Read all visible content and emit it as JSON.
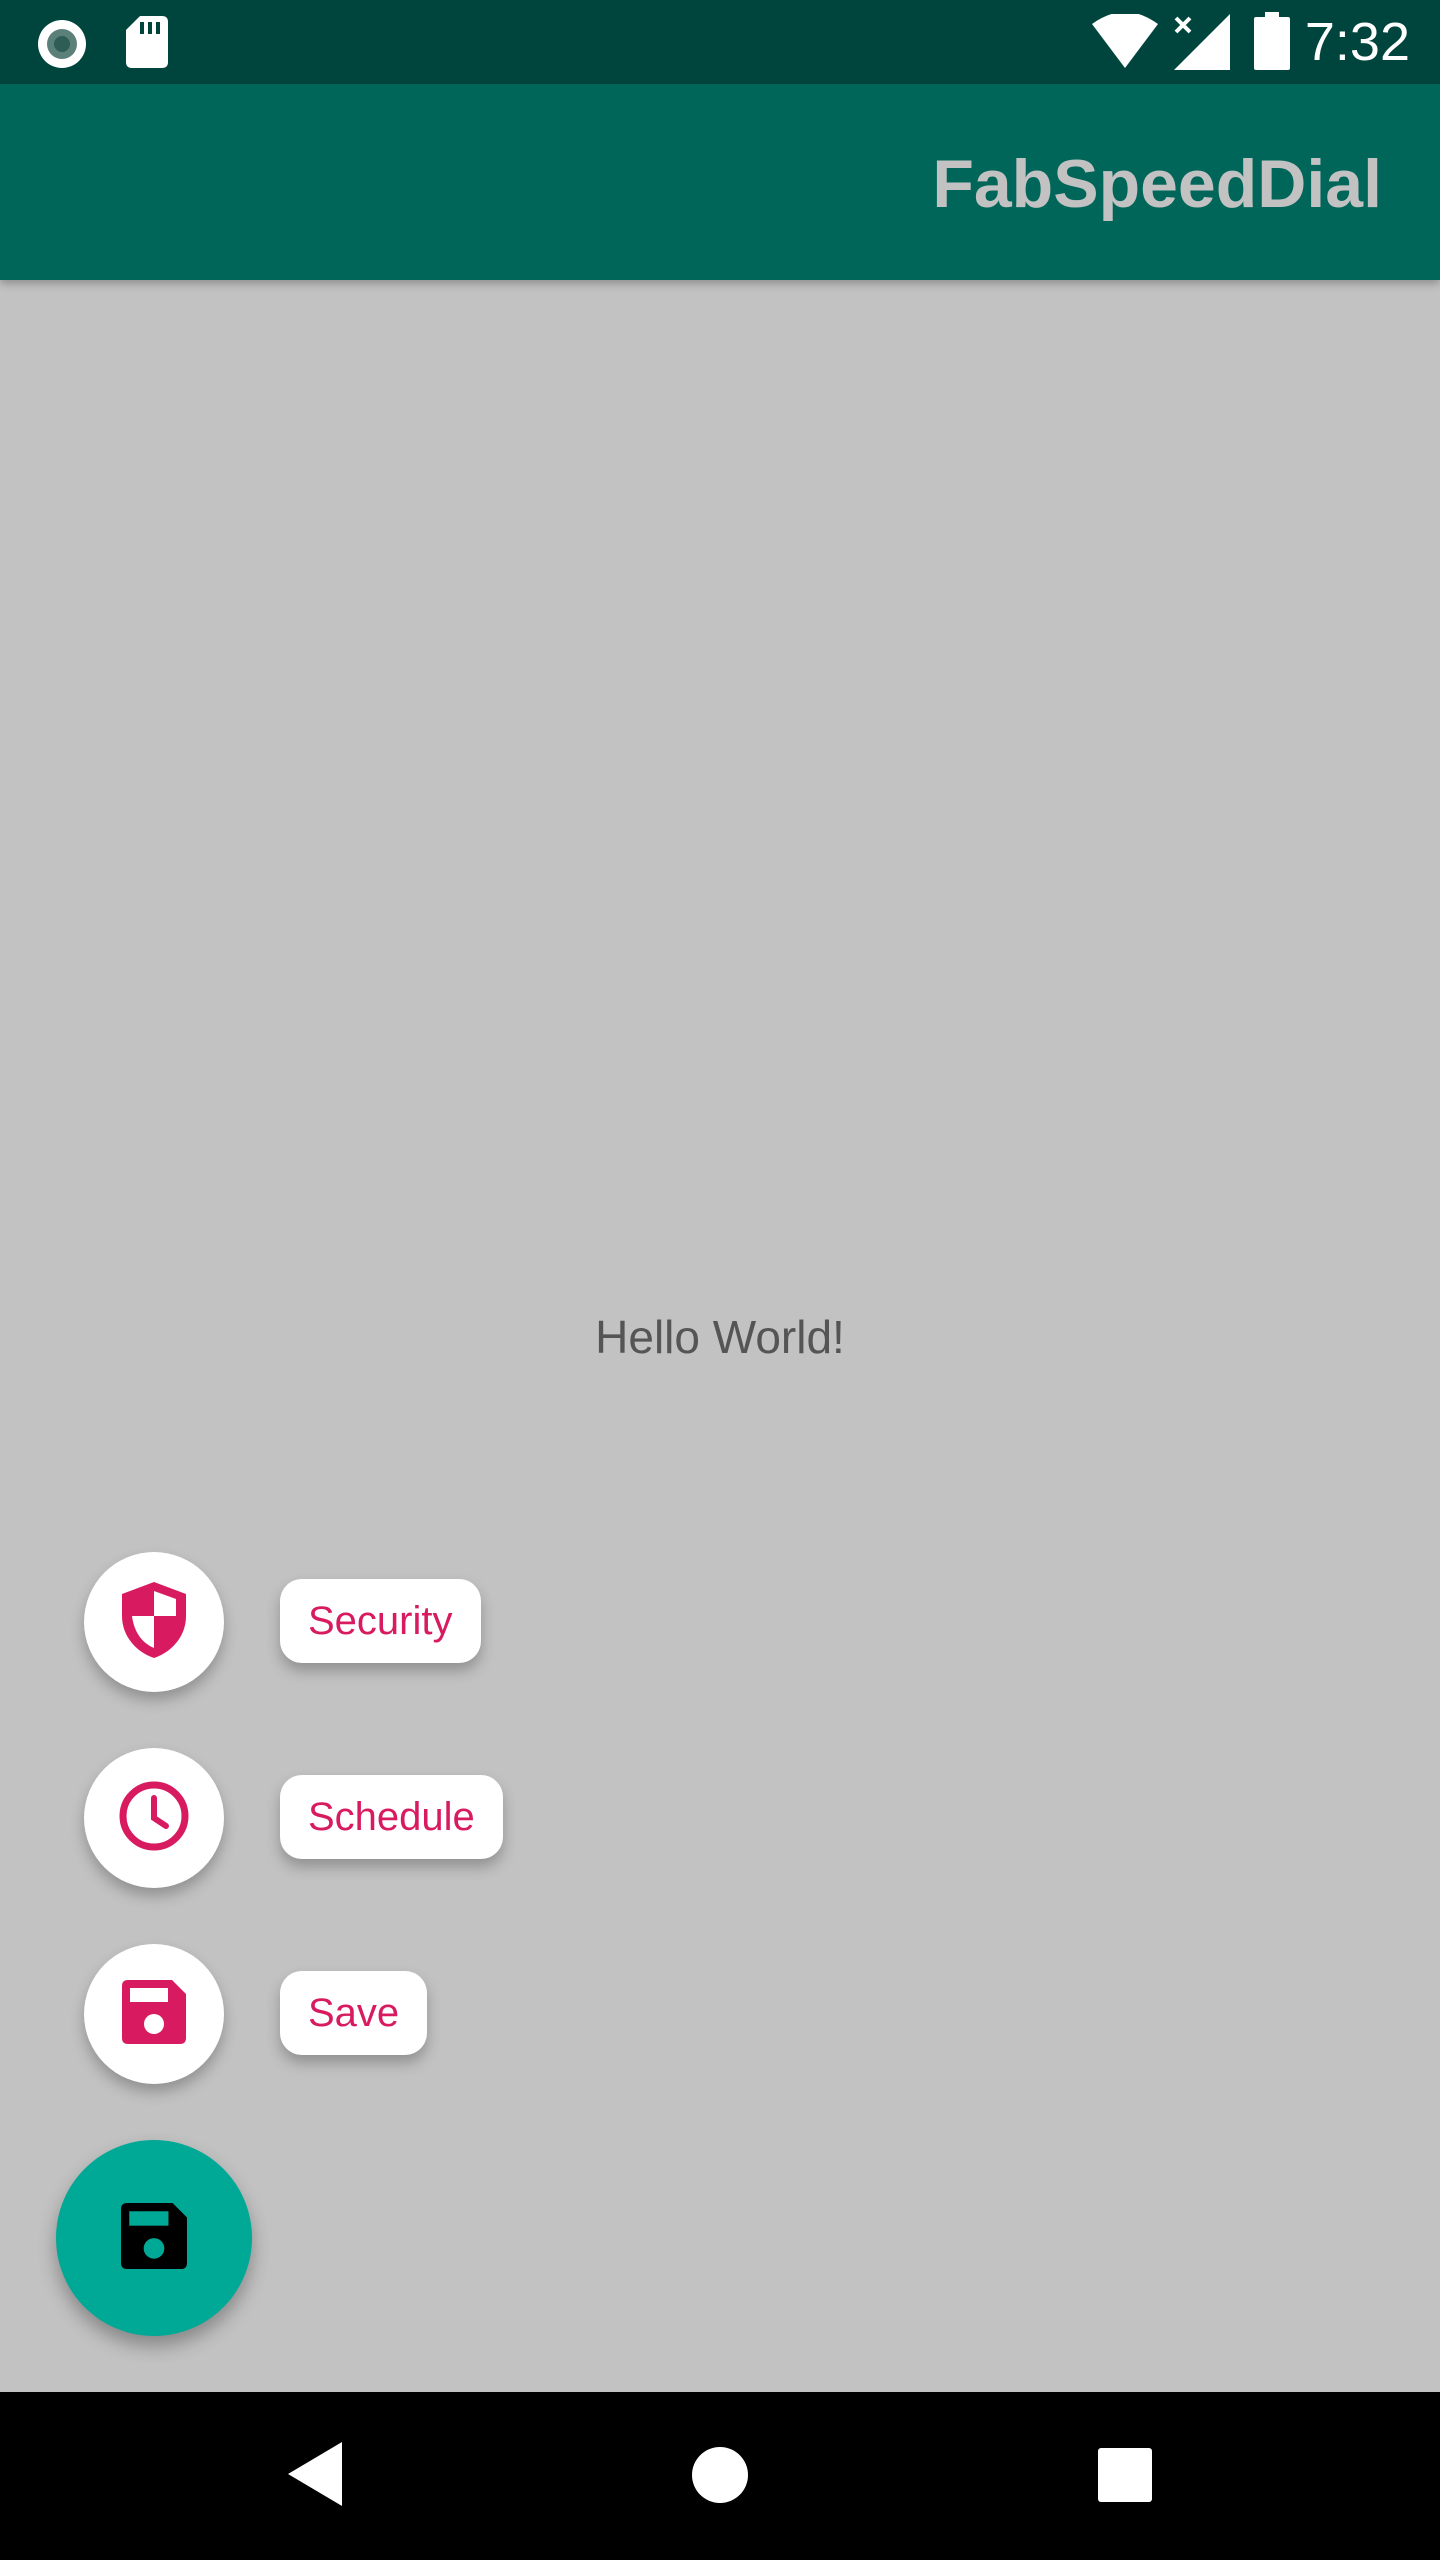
{
  "status_bar": {
    "time": "7:32",
    "left_icons": [
      "record-icon",
      "sd-card-icon"
    ],
    "right_icons": [
      "wifi-icon",
      "cell-signal-icon",
      "battery-icon"
    ]
  },
  "app_bar": {
    "title": "FabSpeedDial"
  },
  "content": {
    "message": "Hello World!"
  },
  "speed_dial": {
    "items": [
      {
        "label": "Security",
        "icon": "shield-icon"
      },
      {
        "label": "Schedule",
        "icon": "clock-icon"
      },
      {
        "label": "Save",
        "icon": "save-icon"
      }
    ],
    "main_icon": "save-icon"
  },
  "nav_bar": {
    "buttons": [
      "back-icon",
      "home-icon",
      "recents-icon"
    ]
  },
  "colors": {
    "status_bar": "#00453d",
    "app_bar": "#00665a",
    "background": "#c2c2c2",
    "accent": "#d81b60",
    "fab": "#00a896"
  }
}
